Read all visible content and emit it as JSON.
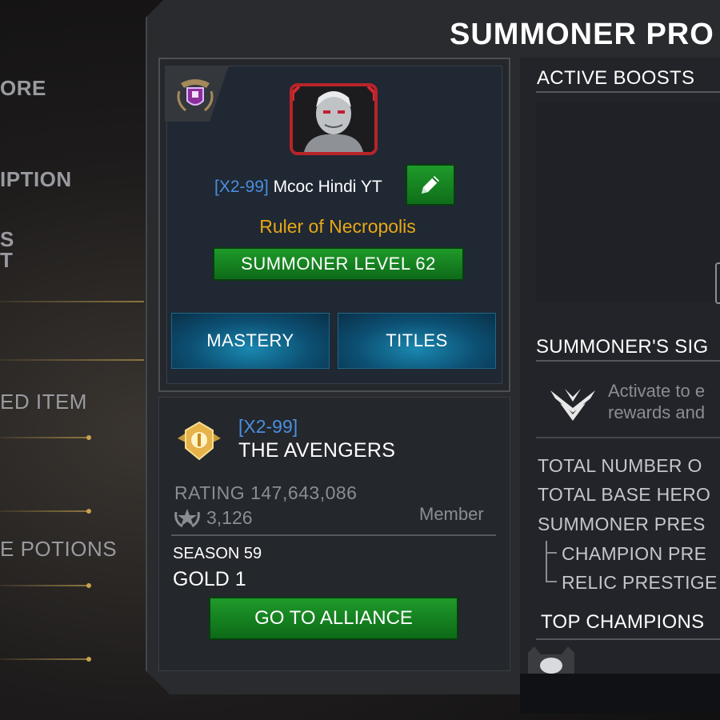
{
  "window": {
    "title": "SUMMONER PRO"
  },
  "side_menu": {
    "items": [
      {
        "label": "ORE"
      },
      {
        "label": "IPTION"
      },
      {
        "label": "S"
      },
      {
        "label": "T"
      },
      {
        "label": "ED ITEM"
      },
      {
        "label": "E POTIONS"
      }
    ]
  },
  "profile": {
    "alliance_tag": "[X2-99]",
    "name": "Mcoc Hindi YT",
    "title": "Ruler of Necropolis",
    "level_label": "SUMMONER LEVEL 62",
    "tabs": [
      {
        "label": "MASTERY"
      },
      {
        "label": "TITLES"
      }
    ]
  },
  "alliance": {
    "tag": "[X2-99]",
    "name": "THE AVENGERS",
    "rating": "RATING 147,643,086",
    "trophies": "3,126",
    "role": "Member",
    "season": "SEASON 59",
    "tier": "GOLD 1",
    "go_button": "GO TO ALLIANCE"
  },
  "right": {
    "active_boosts": "ACTIVE BOOSTS",
    "sigil_head": "SUMMONER'S SIG",
    "sigil_text_1": "Activate to e",
    "sigil_text_2": "rewards and",
    "stats": [
      {
        "label": "TOTAL NUMBER O"
      },
      {
        "label": "TOTAL BASE HERO"
      },
      {
        "label": "SUMMONER PRES"
      },
      {
        "label": "CHAMPION PRE"
      },
      {
        "label": "RELIC PRESTIGE"
      }
    ],
    "top_champions": "TOP CHAMPIONS"
  },
  "colors": {
    "accent_green": "#1f9a2a",
    "tag_blue": "#4a8fe0",
    "title_gold": "#e8a817",
    "tab_blue": "#0c4f72"
  },
  "icons": {
    "emblem": "alliance-crest-icon",
    "edit": "pencil-icon",
    "alliance_badge": "gold-rank-badge-icon",
    "trophy": "trophy-star-icon",
    "sigil": "sigil-chevron-icon"
  }
}
